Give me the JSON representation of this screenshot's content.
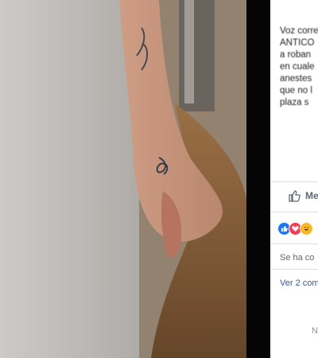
{
  "post": {
    "text_lines": [
      "Voz corre",
      "ANTICO",
      "a roban",
      "en cuale",
      "anestes",
      "que no l",
      "plaza s"
    ]
  },
  "actions": {
    "like_label": "Me"
  },
  "reactions": [
    {
      "name": "like",
      "color": "#1877f2",
      "glyph": "👍"
    },
    {
      "name": "love",
      "color": "#f33e58",
      "glyph": "♥"
    },
    {
      "name": "haha",
      "color": "#f7b928",
      "glyph": "😆"
    }
  ],
  "comments": {
    "shared_text": "Se ha co",
    "view_more": "Ver 2 com"
  },
  "footer": {
    "text": "N"
  },
  "colors": {
    "link": "#385898",
    "muted": "#90949c",
    "panel_bg": "#ffffff"
  }
}
